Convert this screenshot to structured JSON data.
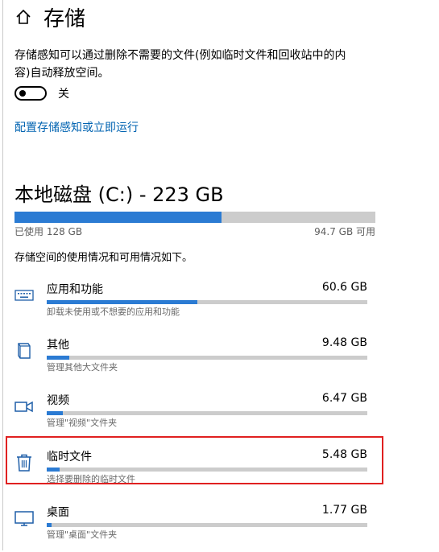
{
  "header": {
    "title": "存储",
    "home_icon": "home-icon"
  },
  "storage_sense": {
    "description": "存储感知可以通过删除不需要的文件(例如临时文件和回收站中的内容)自动释放空间。",
    "toggle_state": "off",
    "toggle_label": "关",
    "config_link": "配置存储感知或立即运行"
  },
  "drive": {
    "title": "本地磁盘 (C:) - 223 GB",
    "used_label": "已使用 128 GB",
    "free_label": "94.7 GB 可用",
    "used_fraction": 0.574,
    "usage_description": "存储空间的使用情况和可用情况如下。"
  },
  "categories": [
    {
      "name": "应用和功能",
      "size": "60.6 GB",
      "sub": "卸载未使用或不想要的应用和功能",
      "icon": "keyboard-icon",
      "fraction": 0.47
    },
    {
      "name": "其他",
      "size": "9.48 GB",
      "sub": "管理其他大文件夹",
      "icon": "folder-icon",
      "fraction": 0.07
    },
    {
      "name": "视频",
      "size": "6.47 GB",
      "sub": "管理\"视频\"文件夹",
      "icon": "video-camera-icon",
      "fraction": 0.05
    },
    {
      "name": "临时文件",
      "size": "5.48 GB",
      "sub": "选择要删除的临时文件",
      "icon": "trash-icon",
      "fraction": 0.04,
      "highlighted": true
    },
    {
      "name": "桌面",
      "size": "1.77 GB",
      "sub": "管理\"桌面\"文件夹",
      "icon": "monitor-icon",
      "fraction": 0.015
    }
  ],
  "colors": {
    "accent": "#2b7bd3",
    "link": "#0063b1",
    "bar_bg": "#cccccc",
    "highlight": "#e02020"
  }
}
